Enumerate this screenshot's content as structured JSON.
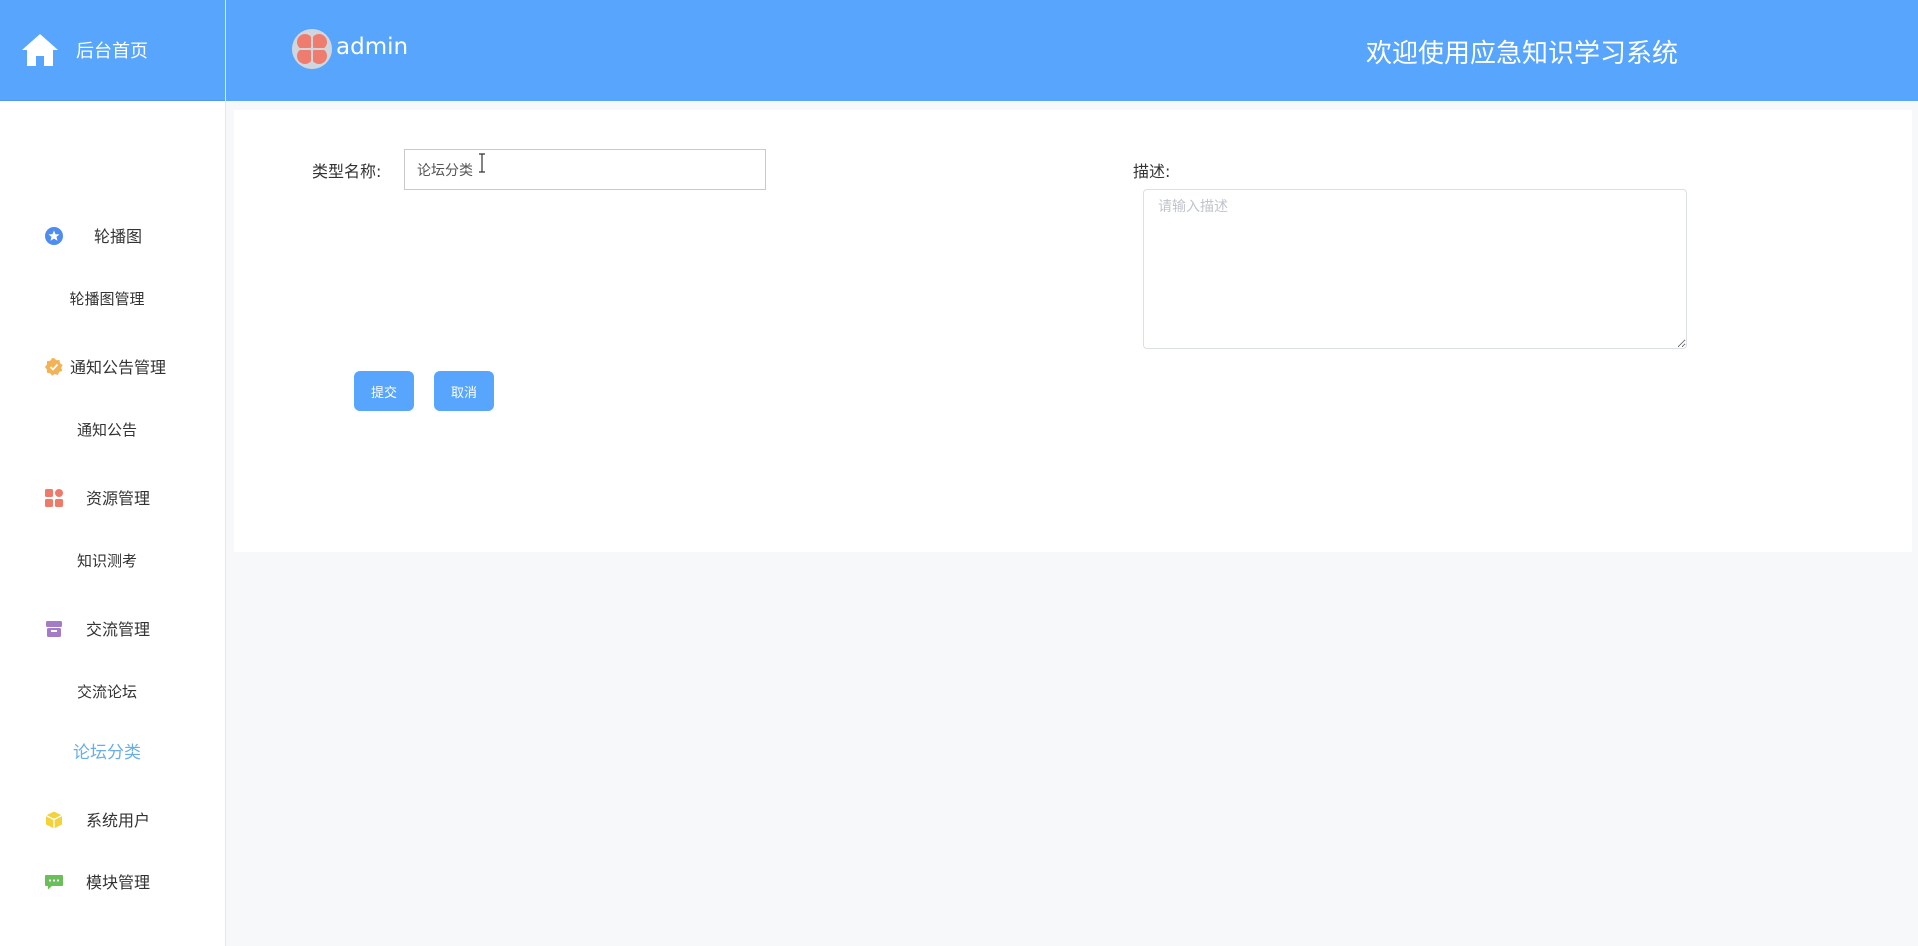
{
  "brand": {
    "label": "后台首页",
    "icon": "home-icon"
  },
  "header": {
    "username": "admin",
    "welcome": "欢迎使用应急知识学习系统"
  },
  "sidebar": {
    "groups": [
      {
        "label": "轮播图",
        "icon": "star-badge-icon",
        "color": "#4f8cf0",
        "items": [
          "轮播图管理"
        ]
      },
      {
        "label": "通知公告管理",
        "icon": "verified-badge-icon",
        "color": "#f4b254",
        "items": [
          "通知公告"
        ]
      },
      {
        "label": "资源管理",
        "icon": "grid-apps-icon",
        "color": "#f07a6a",
        "items": [
          "知识测考"
        ]
      },
      {
        "label": "交流管理",
        "icon": "archive-box-icon",
        "color": "#a47bc6",
        "items": [
          "交流论坛",
          "论坛分类"
        ]
      },
      {
        "label": "系统用户",
        "icon": "cube-icon",
        "color": "#f4d23a",
        "items": []
      },
      {
        "label": "模块管理",
        "icon": "chat-bubble-icon",
        "color": "#6bbf5a",
        "items": []
      }
    ],
    "active_item": "论坛分类"
  },
  "form": {
    "name_label": "类型名称:",
    "name_value": "论坛分类",
    "desc_label": "描述:",
    "desc_placeholder": "请输入描述",
    "submit_label": "提交",
    "cancel_label": "取消"
  },
  "colors": {
    "primary": "#57a5fd",
    "active_text": "#69aee8",
    "background": "#f7f8fa"
  }
}
